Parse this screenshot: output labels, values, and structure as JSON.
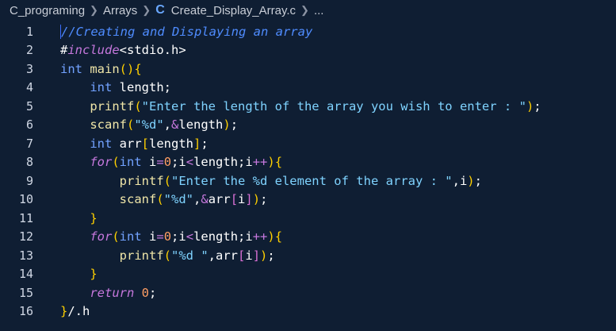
{
  "breadcrumb": {
    "folder": "C_programing",
    "subfolder": "Arrays",
    "file_icon": "C",
    "file": "Create_Display_Array.c",
    "more": "..."
  },
  "editor": {
    "line_numbers": [
      "1",
      "2",
      "3",
      "4",
      "5",
      "6",
      "7",
      "8",
      "9",
      "10",
      "11",
      "12",
      "13",
      "14",
      "15",
      "16"
    ],
    "lines": [
      "//Creating and Displaying an array",
      "#include<stdio.h>",
      "int main(){",
      "    int length;",
      "    printf(\"Enter the length of the array you wish to enter : \");",
      "    scanf(\"%d\",&length);",
      "    int arr[length];",
      "    for(int i=0;i<length;i++){",
      "        printf(\"Enter the %d element of the array : \",i);",
      "        scanf(\"%d\",&arr[i]);",
      "    }",
      "    for(int i=0;i<length;i++){",
      "        printf(\"%d \",arr[i]);",
      "    }",
      "    return 0;",
      "}/.h"
    ]
  },
  "colors": {
    "background": "#0f1e33",
    "comment": "#4f8cff",
    "keyword": "#72a2ff",
    "control_keyword": "#c678dd",
    "function": "#f0e6a8",
    "string": "#7fd3ff",
    "number": "#ff9e64"
  }
}
